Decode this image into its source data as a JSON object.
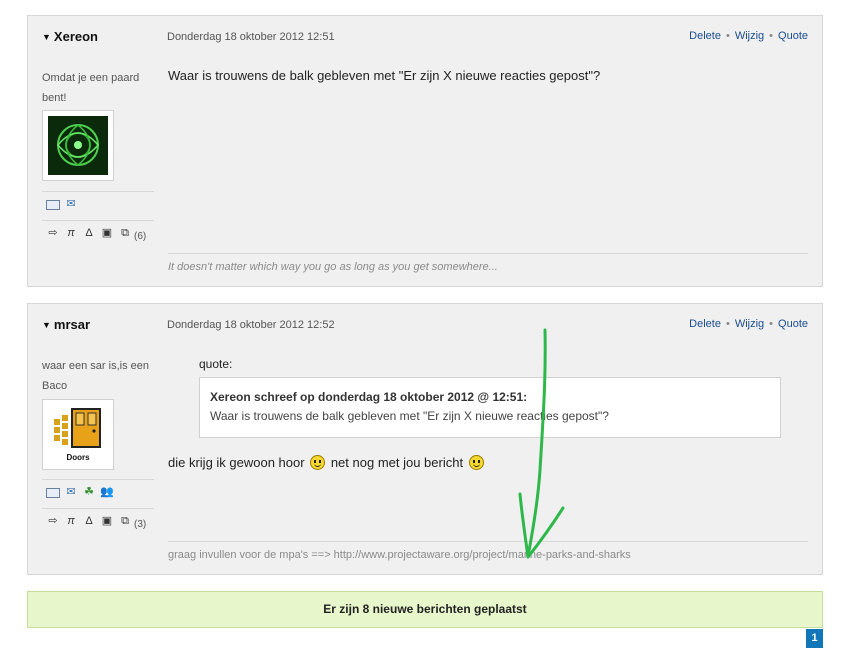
{
  "posts": [
    {
      "username": "Xereon",
      "date": "Donderdag 18 oktober 2012 12:51",
      "actions": {
        "delete": "Delete",
        "edit": "Wijzig",
        "quote": "Quote"
      },
      "user_title": "Omdat je een paard bent!",
      "avatar_icon": "celtic-pattern-avatar",
      "profile_icons": [
        "profile-card-icon",
        "message-icon"
      ],
      "stat_icons": [
        "export-icon",
        "pi-icon",
        "delta-icon",
        "devices-icon",
        "copy-icon"
      ],
      "stat_count": "(6)",
      "content": "Waar is trouwens de balk gebleven met \"Er zijn X nieuwe reacties gepost\"?",
      "signature": "It doesn't matter which way you go as long as you get somewhere..."
    },
    {
      "username": "mrsar",
      "date": "Donderdag 18 oktober 2012 12:52",
      "actions": {
        "delete": "Delete",
        "edit": "Wijzig",
        "quote": "Quote"
      },
      "user_title": "waar een sar is,is een Baco",
      "avatar_icon": "doors-logo-avatar",
      "avatar_text": "Doors",
      "profile_icons": [
        "profile-card-icon",
        "message-icon",
        "clover-icon",
        "users-icon"
      ],
      "stat_icons": [
        "export-icon",
        "pi-icon",
        "delta-icon",
        "devices-icon",
        "copy-icon"
      ],
      "stat_count": "(3)",
      "quote_label": "quote:",
      "quote_author": "Xereon schreef op donderdag 18 oktober 2012 @ 12:51:",
      "quote_text": "Waar is trouwens de balk gebleven met \"Er zijn X nieuwe reacties gepost\"?",
      "reply_part1": "die krijg ik gewoon hoor",
      "reply_part2": "net nog met jou bericht",
      "signature": "graag invullen voor de mpa's ==> http://www.projectaware.org/project/marine-parks-and-sharks"
    }
  ],
  "notice": "Er zijn 8 nieuwe berichten geplaatst",
  "pagination": {
    "current_page": "1"
  },
  "colors": {
    "post_bg": "#f0f0f0",
    "link": "#1a4d8f",
    "notice_bg": "#e8f6cc",
    "pager_bg": "#1277b8",
    "annotation_arrow": "#2eb84a"
  }
}
